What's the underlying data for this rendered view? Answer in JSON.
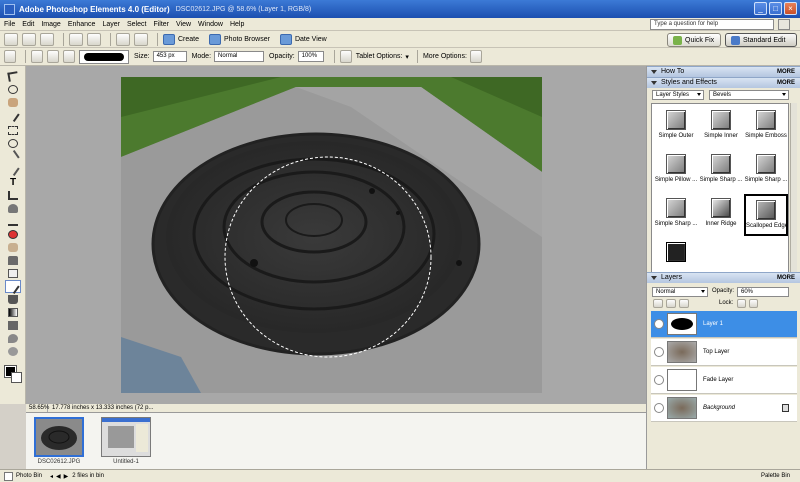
{
  "title": {
    "app": "Adobe Photoshop Elements 4.0 (Editor)",
    "doc": "DSC02612.JPG @ 58.6% (Layer 1, RGB/8)"
  },
  "menu": [
    "File",
    "Edit",
    "Image",
    "Enhance",
    "Layer",
    "Select",
    "Filter",
    "View",
    "Window",
    "Help"
  ],
  "help_placeholder": "Type a question for help",
  "shortcuts": {
    "create": "Create",
    "photo_browser": "Photo Browser",
    "date_view": "Date View",
    "quick_fix": "Quick Fix",
    "standard_edit": "Standard Edit"
  },
  "options": {
    "size_label": "Size:",
    "size_value": "453 px",
    "mode_label": "Mode:",
    "mode_value": "Normal",
    "opacity_label": "Opacity:",
    "opacity_value": "100%",
    "tablet_label": "Tablet Options:",
    "more_label": "More Options:"
  },
  "status": {
    "zoom": "58.65%",
    "doc_size": "17.778 inches x 13.333 inches (72 p..."
  },
  "bin": {
    "thumbs": [
      {
        "label": "DSC02612.JPG",
        "selected": true
      },
      {
        "label": "Untitled-1",
        "selected": false
      }
    ]
  },
  "panels": {
    "more": "MORE",
    "howto": "How To",
    "styles": "Styles and Effects",
    "styles_dd1": "Layer Styles",
    "styles_dd2": "Bevels",
    "style_items": [
      "Simple Outer",
      "Simple Inner",
      "Simple Emboss",
      "Simple Pillow ...",
      "Simple Sharp ...",
      "Simple Sharp ...",
      "Simple Sharp ...",
      "Inner Ridge",
      "Scalloped Edge",
      ""
    ],
    "layers": "Layers",
    "blend": "Normal",
    "opacity_label": "Opacity:",
    "opacity_value": "60%",
    "lock_label": "Lock:",
    "layer_rows": [
      {
        "name": "Layer 1",
        "selected": true
      },
      {
        "name": "Top Layer",
        "selected": false
      },
      {
        "name": "Fade Layer",
        "selected": false
      },
      {
        "name": "Background",
        "selected": false
      }
    ]
  },
  "statusbar": {
    "photo_bin": "Photo Bin",
    "files_in_bin": "2 files in bin",
    "palette_bin": "Palette Bin"
  },
  "colors": {
    "accent": "#3d8ee6",
    "title_bar": "#2a62c6"
  }
}
